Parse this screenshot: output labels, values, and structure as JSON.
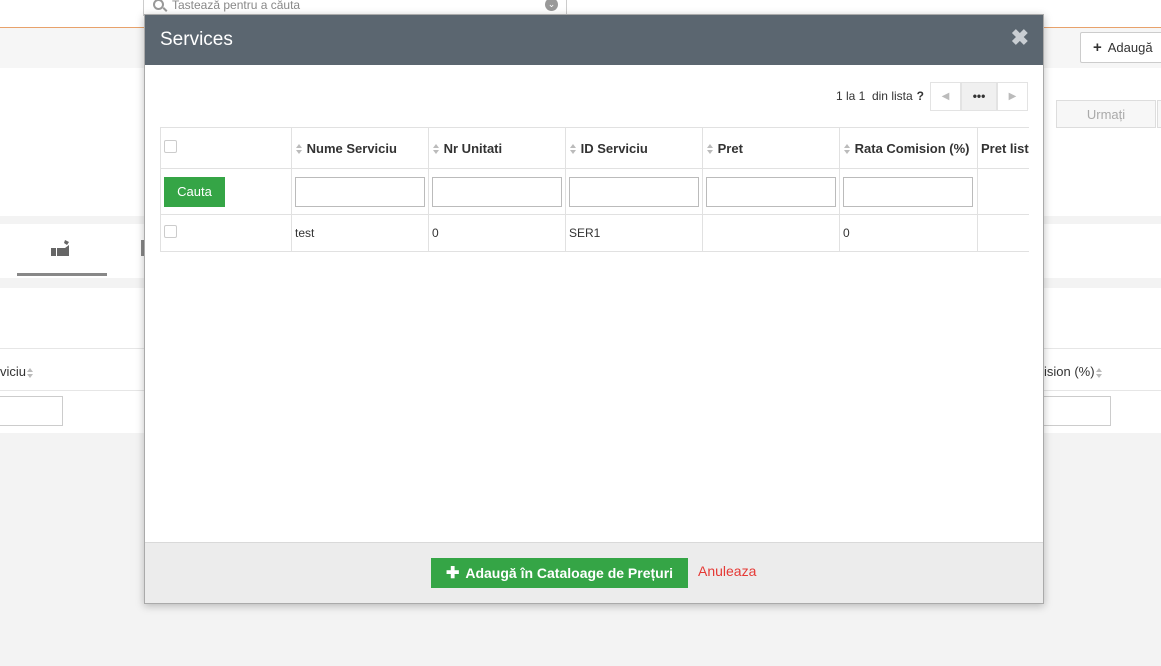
{
  "background": {
    "search_placeholder": "Tastează pentru a căuta",
    "add_button_label": "Adaugă",
    "next_button_label": "Urmați",
    "col_left_label": "viciu",
    "col_right_label": "ision (%)"
  },
  "modal": {
    "title": "Services",
    "close_glyph": "✖",
    "pager": {
      "range_text": "1 la 1",
      "of_list_text": "din lista",
      "help_glyph": "?",
      "prev_glyph": "◀",
      "more_glyph": "•••",
      "next_glyph": "▶"
    },
    "table": {
      "columns": [
        "Nume Serviciu",
        "Nr Unitati",
        "ID Serviciu",
        "Pret",
        "Rata Comision (%)",
        "Pret lista"
      ],
      "search_button_label": "Cauta",
      "rows": [
        {
          "nume": "test",
          "unitati": "0",
          "id": "SER1",
          "pret": "",
          "rata": "0",
          "pret_lista": ""
        }
      ]
    },
    "footer": {
      "add_button_label": "Adaugă în Cataloage de Prețuri",
      "cancel_label": "Anuleaza"
    }
  }
}
